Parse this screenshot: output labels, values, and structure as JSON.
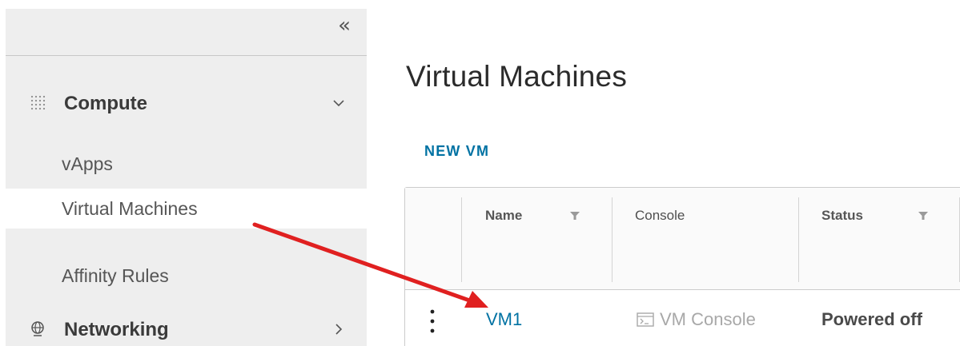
{
  "sidebar": {
    "collapse_glyph": "«",
    "groups": [
      {
        "label": "Compute",
        "icon": "grid-dots-icon",
        "chevron": "down"
      },
      {
        "label": "Networking",
        "icon": "network-globe-icon",
        "chevron": "right"
      }
    ],
    "items": [
      {
        "label": "vApps",
        "selected": false
      },
      {
        "label": "Virtual Machines",
        "selected": true
      },
      {
        "label": "Affinity Rules",
        "selected": false
      }
    ]
  },
  "main": {
    "title": "Virtual Machines",
    "new_vm_label": "NEW VM",
    "grid": {
      "columns": [
        {
          "label": "Name",
          "filterable": true
        },
        {
          "label": "Console",
          "filterable": false
        },
        {
          "label": "Status",
          "filterable": true
        }
      ],
      "rows": [
        {
          "name": "VM1",
          "console": "VM Console",
          "status": "Powered off"
        }
      ]
    }
  },
  "annotation": {
    "arrow_color": "#e02020",
    "from": "Virtual Machines",
    "to": "VM1"
  },
  "colors": {
    "link": "#0072a3",
    "sidebar_bg": "#eeeeee",
    "selected_bg": "#ffffff"
  }
}
